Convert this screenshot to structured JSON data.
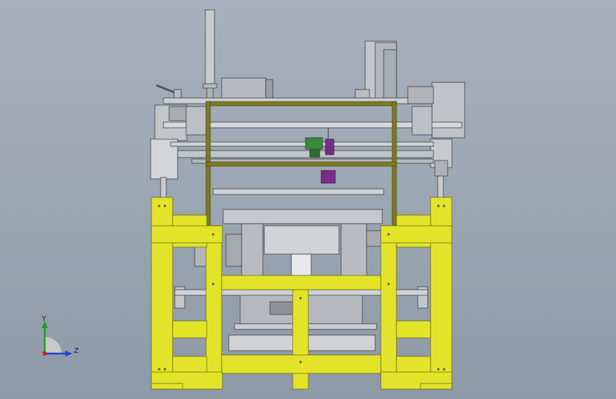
{
  "viewport": {
    "triad": {
      "y_label": "Y",
      "z_label": "Z"
    }
  },
  "colors": {
    "background": "#9ea8b5",
    "frame_yellow": "#e3e32a",
    "frame_olive": "#7d7a25",
    "steel": "#c6c9cc",
    "steel_dark": "#8b8f94",
    "purple_part": "#7a2a88",
    "green_part": "#3a8a3a",
    "axis_y": "#19a019",
    "axis_z": "#2040e0",
    "axis_x": "#d02020"
  }
}
